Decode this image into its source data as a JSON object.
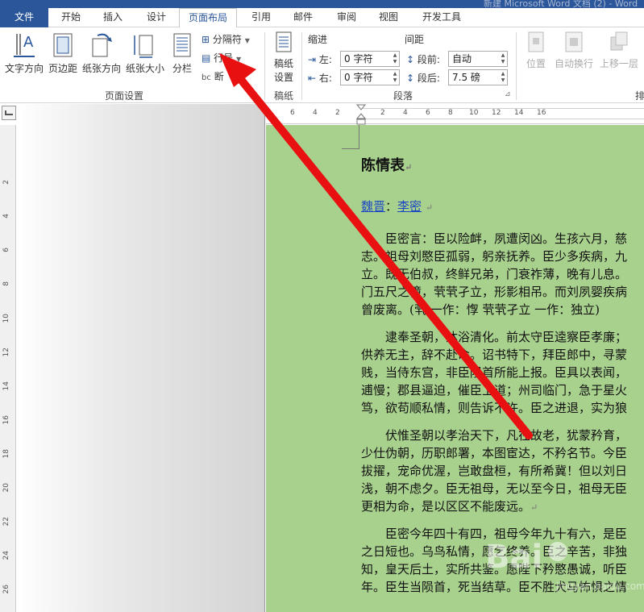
{
  "title_bar": {
    "doc_title": "新建 Microsoft Word 文档 (2) - Word"
  },
  "tabs": [
    {
      "label": "文件"
    },
    {
      "label": "开始"
    },
    {
      "label": "插入"
    },
    {
      "label": "设计"
    },
    {
      "label": "页面布局"
    },
    {
      "label": "引用"
    },
    {
      "label": "邮件"
    },
    {
      "label": "审阅"
    },
    {
      "label": "视图"
    },
    {
      "label": "开发工具"
    }
  ],
  "ribbon": {
    "page_setup": {
      "text_direction": "文字方向",
      "margins": "页边距",
      "orientation": "纸张方向",
      "size": "纸张大小",
      "columns": "分栏",
      "breaks": "分隔符",
      "line_numbers": "行号",
      "hyphenation": "断",
      "group_label": "页面设置"
    },
    "draft": {
      "label_line1": "稿纸",
      "label_line2": "设置",
      "group_label": "稿纸"
    },
    "paragraph": {
      "indent_header": "缩进",
      "spacing_header": "间距",
      "left_label": "左:",
      "left_value": "0 字符",
      "right_label": "右:",
      "right_value": "0 字符",
      "before_label": "段前:",
      "before_value": "自动",
      "after_label": "段后:",
      "after_value": "7.5 磅",
      "group_label": "段落"
    },
    "arrange": {
      "position": "位置",
      "wrap": "自动换行",
      "bring_forward": "上移一层",
      "group_label_partial": "排"
    }
  },
  "ruler": {
    "numbers": [
      "6",
      "4",
      "2",
      "2",
      "4",
      "6",
      "8",
      "10",
      "12",
      "14",
      "16"
    ]
  },
  "vruler": {
    "numbers": [
      "2",
      "4",
      "6",
      "8",
      "10",
      "12",
      "14",
      "16",
      "18",
      "20",
      "22",
      "24",
      "26"
    ]
  },
  "document": {
    "title": "陈情表",
    "author_dynasty": "魏晋",
    "author_sep": "：",
    "author_name": "李密",
    "lines": [
      "　　臣密言：臣以险衅，夙遭闵凶。生孩六月，慈",
      "志。祖母刘愍臣孤弱，躬亲抚养。臣少多疾病，九",
      "立。既无伯叔，终鲜兄弟，门衰祚薄，晚有儿息。",
      "门五尺之僮，茕茕孑立，形影相吊。而刘夙婴疾病",
      "曾废离。(茕 一作：惸 茕茕孑立 一作：独立)",
      "　　逮奉圣朝，沐浴清化。前太守臣逵察臣孝廉；",
      "供养无主，辞不赴命。诏书特下，拜臣郎中，寻蒙",
      "贱，当侍东宫，非臣陨首所能上报。臣具以表闻，",
      "逋慢；郡县逼迫，催臣上道；州司临门，急于星火",
      "笃，欲苟顺私情，则告诉不许。臣之进退，实为狼",
      "　　伏惟圣朝以孝治天下，凡在故老，犹蒙矜育，",
      "少仕伪朝，历职郎署，本图宦达，不矜名节。今臣",
      "拔擢，宠命优渥，岂敢盘桓，有所希冀！但以刘日",
      "浅，朝不虑夕。臣无祖母，无以至今日，祖母无臣",
      "更相为命，是以区区不能废远。",
      "　　臣密今年四十有四，祖母今年九十有六，是臣",
      "之日短也。乌鸟私情，愿乞终养。臣之辛苦，非独",
      "知，皇天后土，实所共鉴。愿陛下矜愍愚诚，听臣",
      "年。臣生当陨首，死当结草。臣不胜犬马怖惧之情"
    ]
  },
  "watermark": {
    "brand": "Bai",
    "site": "jingyan.baidu.com"
  },
  "colors": {
    "file_tab": "#2b579a",
    "page_bg": "#a9d18e",
    "arrow": "#e81010",
    "link": "#1a46c4"
  }
}
